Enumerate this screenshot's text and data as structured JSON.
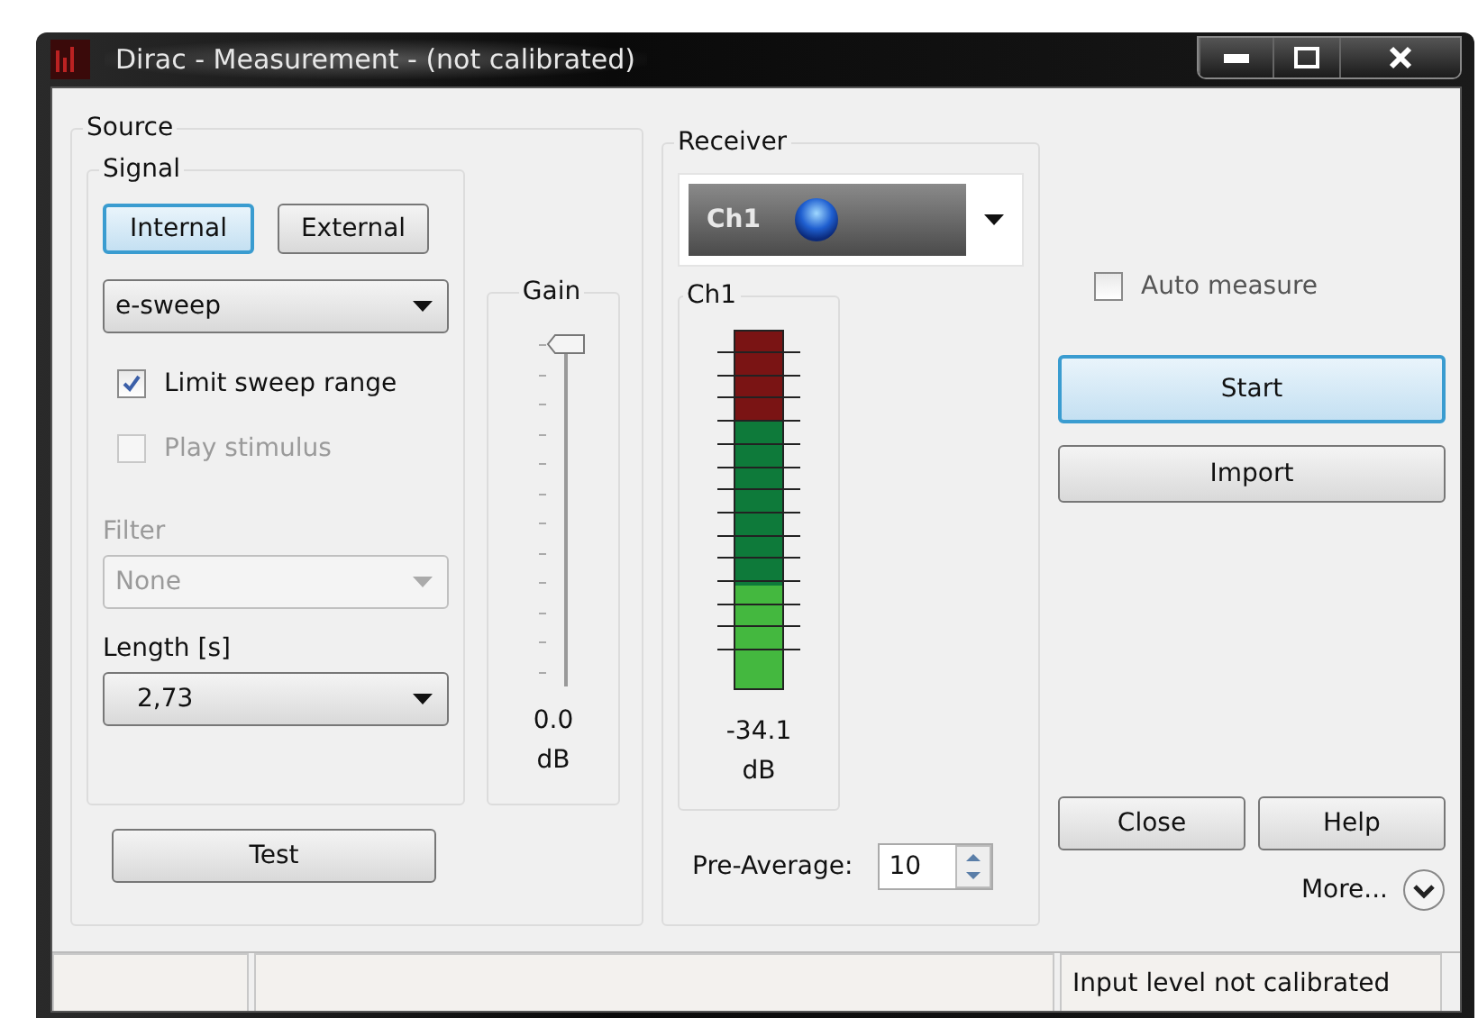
{
  "window": {
    "title": "Dirac - Measurement - (not calibrated)"
  },
  "source": {
    "title": "Source",
    "signal": {
      "title": "Signal",
      "modes": [
        {
          "label": "Internal",
          "selected": true
        },
        {
          "label": "External",
          "selected": false
        }
      ],
      "type": {
        "value": "e-sweep"
      },
      "options": [
        {
          "label": "Limit sweep range",
          "checked": true,
          "disabled": false
        },
        {
          "label": "Play stimulus",
          "checked": false,
          "disabled": true
        }
      ],
      "filter": {
        "label": "Filter",
        "value": "None",
        "disabled": true
      },
      "length": {
        "label": "Length [s]",
        "value": "2,73"
      }
    },
    "gain": {
      "title": "Gain",
      "level": 1,
      "reading": "0.0",
      "unit": "dB"
    },
    "test_button": "Test"
  },
  "receiver": {
    "title": "Receiver",
    "channel": {
      "value": "Ch1"
    },
    "meter": {
      "title": "Ch1",
      "level": 0.29,
      "reading": "-34.1",
      "unit": "dB"
    },
    "pre_average": {
      "label": "Pre-Average:",
      "value": "10"
    }
  },
  "actions": {
    "auto_measure": {
      "label": "Auto measure",
      "checked": false
    },
    "buttons": [
      {
        "label": "Start",
        "focused": true
      },
      {
        "label": "Import",
        "focused": false
      }
    ],
    "close": "Close",
    "help": "Help",
    "more": "More..."
  },
  "status_bar": {
    "message": "Input level not calibrated"
  }
}
